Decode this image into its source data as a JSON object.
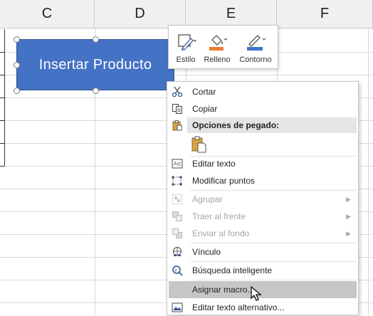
{
  "columns": [
    "C",
    "D",
    "E",
    "F"
  ],
  "shape": {
    "text": "Insertar Producto"
  },
  "mini_toolbar": {
    "style": "Estilo",
    "fill": "Relleno",
    "outline": "Contorno"
  },
  "menu": {
    "cut": "Cortar",
    "copy": "Copiar",
    "paste_options": "Opciones de pegado:",
    "edit_text": "Editar texto",
    "edit_points": "Modificar puntos",
    "group": "Agrupar",
    "bring_front": "Traer al frente",
    "send_back": "Enviar al fondo",
    "link": "Vínculo",
    "smart_lookup": "Búsqueda inteligente",
    "assign_macro": "Asignar macro...",
    "alt_text": "Editar texto alternativo..."
  },
  "colors": {
    "shape_fill": "#4472c4",
    "fill_accent": "#ed7d31",
    "outline_accent": "#4472c4"
  }
}
